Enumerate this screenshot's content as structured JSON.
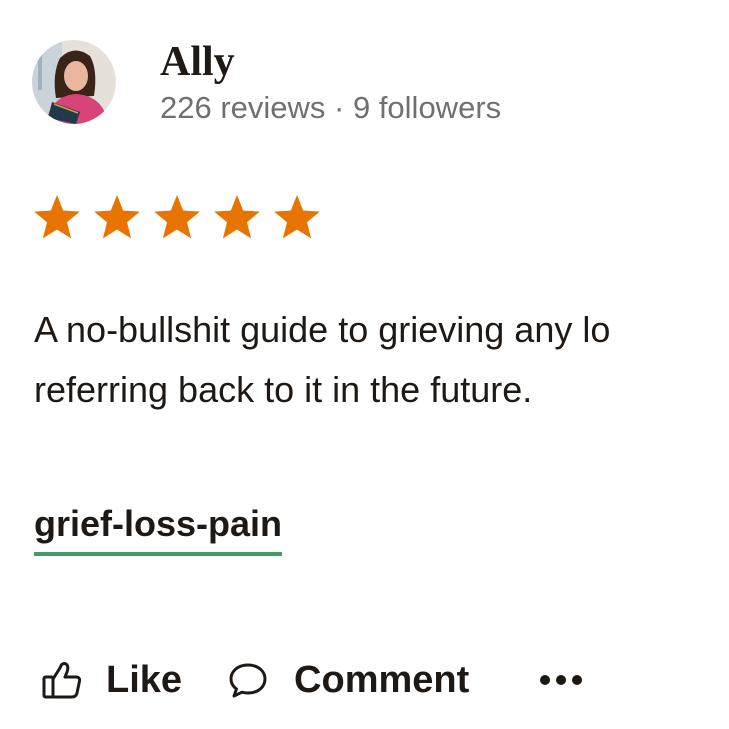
{
  "user": {
    "name": "Ally",
    "stats": "226 reviews · 9 followers"
  },
  "review": {
    "rating": 5,
    "rating_max": 5,
    "star_color": "#e87400",
    "lines": [
      "A no-bullshit guide to grieving any lo",
      "referring back to it in the future."
    ]
  },
  "shelf_tag": {
    "label": "grief-loss-pain",
    "underline_color": "#409d69"
  },
  "actions": {
    "like_label": "Like",
    "comment_label": "Comment",
    "like_icon": "thumbs-up-icon",
    "comment_icon": "speech-bubble-icon",
    "more_icon": "more-dots-icon"
  }
}
